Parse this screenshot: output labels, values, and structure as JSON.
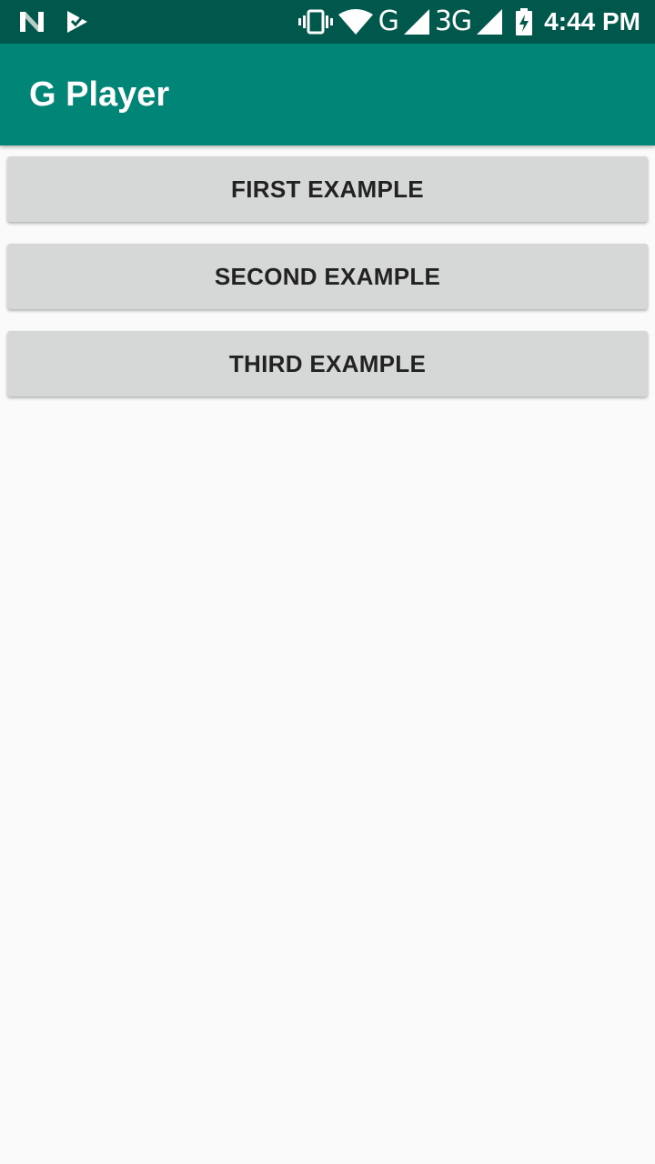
{
  "status_bar": {
    "left_icons": [
      "n-logo-icon",
      "download-check-icon"
    ],
    "right_icons": [
      "vibrate-icon",
      "wifi-icon",
      "signal-icon",
      "signal-icon",
      "battery-charging-icon"
    ],
    "network_1": "G",
    "network_2": "3G",
    "time": "4:44 PM"
  },
  "app_bar": {
    "title": "G Player"
  },
  "buttons": [
    {
      "label": "FIRST EXAMPLE"
    },
    {
      "label": "SECOND EXAMPLE"
    },
    {
      "label": "THIRD EXAMPLE"
    }
  ],
  "colors": {
    "status_bar": "#00574b",
    "app_bar": "#008577",
    "background": "#fafafa",
    "button": "#d6d7d7",
    "button_text": "#222222"
  }
}
